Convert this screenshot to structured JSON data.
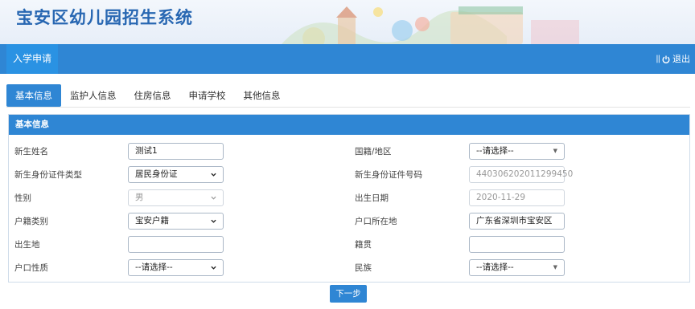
{
  "app": {
    "title": "宝安区幼儿园招生系统"
  },
  "topnav": {
    "tab": "入学申请",
    "separator": "||",
    "logout": "退出"
  },
  "tabs": [
    "基本信息",
    "监护人信息",
    "住房信息",
    "申请学校",
    "其他信息"
  ],
  "panel": {
    "heading": "基本信息"
  },
  "form": {
    "left": [
      {
        "label": "新生姓名",
        "value": "测试1"
      },
      {
        "label": "新生身份证件类型",
        "value": "居民身份证"
      },
      {
        "label": "性别",
        "value": "男"
      },
      {
        "label": "户籍类别",
        "value": "宝安户籍"
      },
      {
        "label": "出生地",
        "value": ""
      },
      {
        "label": "户口性质",
        "value": "--请选择--"
      }
    ],
    "right": [
      {
        "label": "国籍/地区",
        "value": "--请选择--"
      },
      {
        "label": "新生身份证件号码",
        "value": "440306202011299450"
      },
      {
        "label": "出生日期",
        "value": "2020-11-29"
      },
      {
        "label": "户口所在地",
        "value": "广东省深圳市宝安区"
      },
      {
        "label": "籍贯",
        "value": ""
      },
      {
        "label": "民族",
        "value": "--请选择--"
      }
    ]
  },
  "actions": {
    "next": "下一步"
  },
  "colors": {
    "primary": "#2f86d4",
    "title": "#2867b2"
  }
}
